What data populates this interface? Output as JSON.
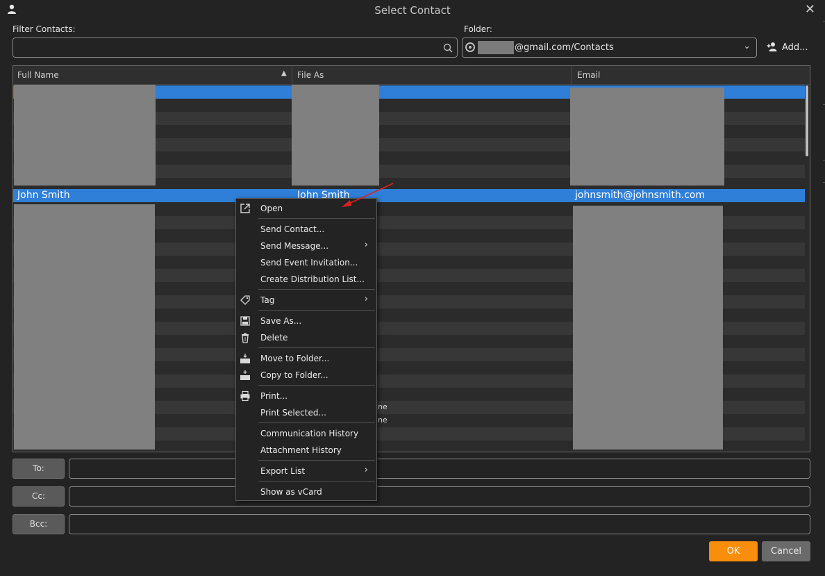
{
  "window": {
    "title": "Select Contact",
    "close_glyph": "✕"
  },
  "filter": {
    "label": "Filter Contacts:",
    "value": "",
    "placeholder": ""
  },
  "folder": {
    "label": "Folder:",
    "value": "@gmail.com/Contacts"
  },
  "add_label": "Add...",
  "columns": {
    "full_name": "Full Name",
    "file_as": "File As",
    "email": "Email"
  },
  "selected_contact": {
    "full_name": "John Smith",
    "file_as": "John Smith",
    "email": "johnsmith@johnsmith.com"
  },
  "partial_text": {
    "row_a": "ne",
    "row_b": "ne"
  },
  "recipients": {
    "to": "To:",
    "cc": "Cc:",
    "bcc": "Bcc:"
  },
  "buttons": {
    "ok": "OK",
    "cancel": "Cancel"
  },
  "context_menu": {
    "items": [
      {
        "label": "Open",
        "icon": "open-external-icon"
      },
      {
        "label": "Send Contact..."
      },
      {
        "label": "Send Message...",
        "submenu": true
      },
      {
        "label": "Send Event Invitation..."
      },
      {
        "label": "Create Distribution List..."
      },
      {
        "label": "Tag",
        "icon": "tag-icon",
        "submenu": true
      },
      {
        "label": "Save As...",
        "icon": "save-icon"
      },
      {
        "label": "Delete",
        "icon": "trash-icon"
      },
      {
        "label": "Move to Folder...",
        "icon": "move-folder-icon"
      },
      {
        "label": "Copy to Folder...",
        "icon": "copy-folder-icon"
      },
      {
        "label": "Print...",
        "icon": "printer-icon"
      },
      {
        "label": "Print Selected..."
      },
      {
        "label": "Communication History"
      },
      {
        "label": "Attachment History"
      },
      {
        "label": "Export List",
        "submenu": true
      },
      {
        "label": "Show as vCard"
      }
    ]
  },
  "colors": {
    "selection": "#2f7fd8",
    "ok_button": "#f98e0c",
    "background": "#232323",
    "annotation_arrow": "#e0201e"
  }
}
